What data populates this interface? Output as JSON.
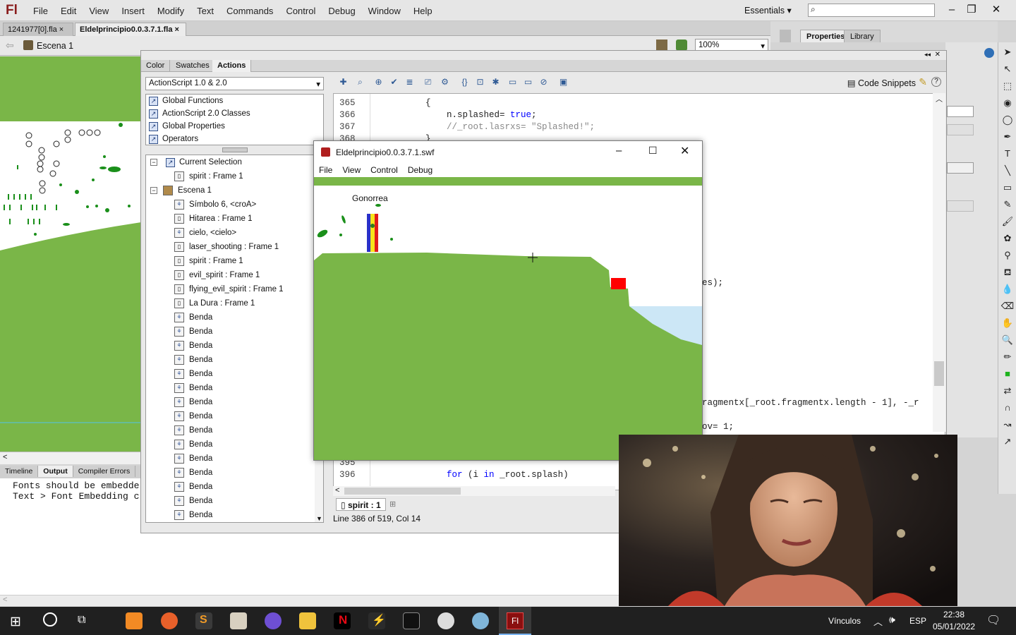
{
  "app": {
    "logo": "Fl",
    "menus": [
      "File",
      "Edit",
      "View",
      "Insert",
      "Modify",
      "Text",
      "Commands",
      "Control",
      "Debug",
      "Window",
      "Help"
    ],
    "workspace": "Essentials",
    "search_value": ""
  },
  "doc_tabs": [
    "1241977[0].fla",
    "Eldelprincipio0.0.3.7.1.fla"
  ],
  "scene": {
    "name": "Escena 1",
    "zoom": "100%"
  },
  "right_panel_tabs": [
    "Properties",
    "Library"
  ],
  "bottom_tabs": [
    "Timeline",
    "Output",
    "Compiler Errors"
  ],
  "output_lines": [
    "Fonts should be embedde",
    "Text > Font Embedding c"
  ],
  "actions_panel": {
    "tabs": [
      "Color",
      "Swatches",
      "Actions"
    ],
    "version": "ActionScript 1.0 & 2.0",
    "library": [
      "Global Functions",
      "ActionScript 2.0 Classes",
      "Global Properties",
      "Operators"
    ],
    "code_snippets": "Code Snippets",
    "tree": [
      {
        "label": "Current Selection",
        "type": "header"
      },
      {
        "label": "spirit : Frame 1",
        "type": "frame"
      },
      {
        "label": "Escena 1",
        "type": "scene"
      },
      {
        "label": "Símbolo 6, <croA>",
        "type": "symbol"
      },
      {
        "label": "Hitarea : Frame 1",
        "type": "frame"
      },
      {
        "label": "cielo, <cielo>",
        "type": "symbol"
      },
      {
        "label": "laser_shooting : Frame 1",
        "type": "frame"
      },
      {
        "label": "spirit : Frame 1",
        "type": "frame"
      },
      {
        "label": "evil_spirit : Frame 1",
        "type": "frame"
      },
      {
        "label": "flying_evil_spirit : Frame 1",
        "type": "frame"
      },
      {
        "label": "La Dura : Frame 1",
        "type": "frame"
      },
      {
        "label": "Benda",
        "type": "symbol"
      },
      {
        "label": "Benda",
        "type": "symbol"
      },
      {
        "label": "Benda",
        "type": "symbol"
      },
      {
        "label": "Benda",
        "type": "symbol"
      },
      {
        "label": "Benda",
        "type": "symbol"
      },
      {
        "label": "Benda",
        "type": "symbol"
      },
      {
        "label": "Benda",
        "type": "symbol"
      },
      {
        "label": "Benda",
        "type": "symbol"
      },
      {
        "label": "Benda",
        "type": "symbol"
      },
      {
        "label": "Benda",
        "type": "symbol"
      },
      {
        "label": "Benda",
        "type": "symbol"
      },
      {
        "label": "Benda",
        "type": "symbol"
      },
      {
        "label": "Benda",
        "type": "symbol"
      },
      {
        "label": "Benda",
        "type": "symbol"
      },
      {
        "label": "Benda",
        "type": "symbol"
      }
    ],
    "code_lines": [
      {
        "n": "365",
        "t": "        {"
      },
      {
        "n": "366",
        "t": "            n.splashed= true;"
      },
      {
        "n": "367",
        "t": "            //_root.lasrxs= \"Splashed!\";"
      },
      {
        "n": "368",
        "t": "        }"
      },
      {
        "n": "",
        "t": ""
      },
      {
        "n": "395",
        "t": ""
      },
      {
        "n": "396",
        "t": "            for (i in _root.splash)"
      }
    ],
    "code_fragments": [
      "es);",
      "ragmentx[_root.fragmentx.length - 1], -_r",
      "ov= 1;"
    ],
    "frame_tab": "spirit : 1",
    "status": "Line 386 of 519, Col 14"
  },
  "swf_window": {
    "title": "Eldelprincipio0.0.3.7.1.swf",
    "menus": [
      "File",
      "View",
      "Control",
      "Debug"
    ],
    "game_label": "Gonorrea"
  },
  "taskbar": {
    "links": "Vínculos",
    "lang": "ESP",
    "time": "22:38",
    "date": "05/01/2022"
  },
  "colors": {
    "ground": "#7ab648",
    "water": "#cce7f6",
    "enemy": "#ff0000",
    "taskbar": "#202020"
  }
}
